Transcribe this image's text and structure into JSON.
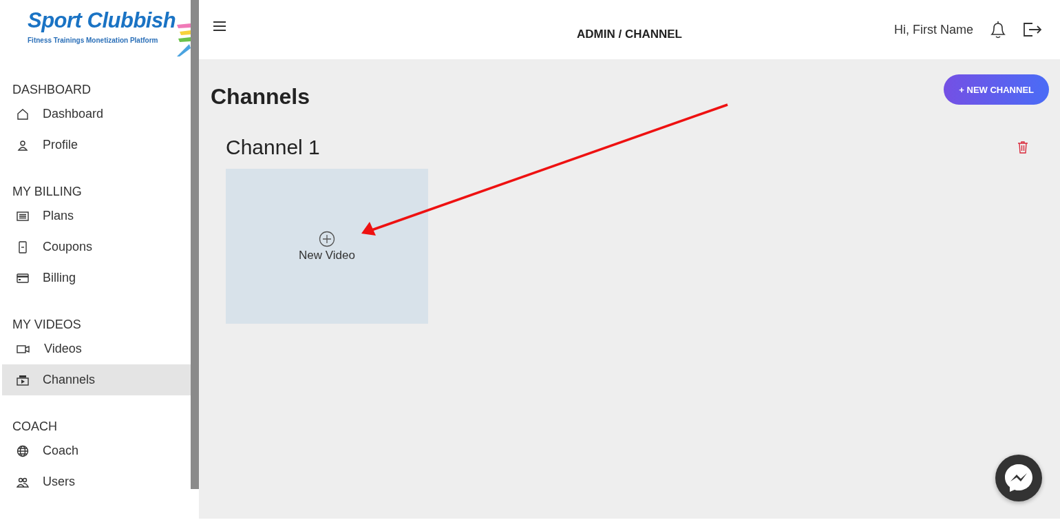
{
  "logo": {
    "title": "Sport Clubbish",
    "tagline": "Fitness Trainings Monetization Platform"
  },
  "sidebar": {
    "sections": [
      {
        "heading": "DASHBOARD",
        "items": [
          {
            "label": "Dashboard",
            "selected": false
          },
          {
            "label": "Profile",
            "selected": false
          }
        ]
      },
      {
        "heading": "MY BILLING",
        "items": [
          {
            "label": "Plans",
            "selected": false
          },
          {
            "label": "Coupons",
            "selected": false
          },
          {
            "label": "Billing",
            "selected": false
          }
        ]
      },
      {
        "heading": "MY VIDEOS",
        "items": [
          {
            "label": "Videos",
            "selected": false
          },
          {
            "label": "Channels",
            "selected": true
          }
        ]
      },
      {
        "heading": "COACH",
        "items": [
          {
            "label": "Coach",
            "selected": false
          },
          {
            "label": "Users",
            "selected": false
          }
        ]
      }
    ]
  },
  "header": {
    "breadcrumb": "ADMIN / CHANNEL",
    "greeting": "Hi, First Name"
  },
  "page": {
    "title": "Channels",
    "new_button": "+ NEW CHANNEL"
  },
  "channels": [
    {
      "name": "Channel 1",
      "tile_label": "New Video"
    }
  ]
}
